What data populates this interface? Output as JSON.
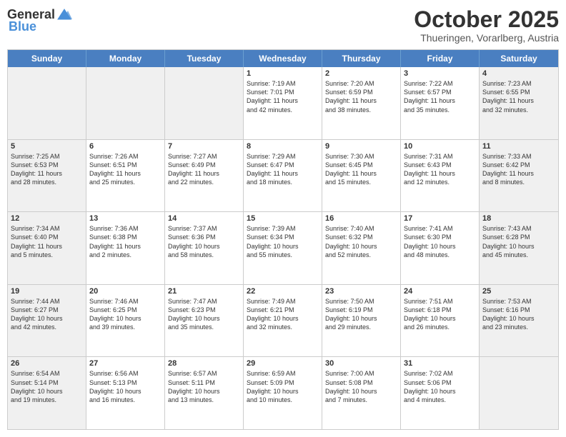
{
  "header": {
    "logo_general": "General",
    "logo_blue": "Blue",
    "month_title": "October 2025",
    "location": "Thueringen, Vorarlberg, Austria"
  },
  "days_of_week": [
    "Sunday",
    "Monday",
    "Tuesday",
    "Wednesday",
    "Thursday",
    "Friday",
    "Saturday"
  ],
  "weeks": [
    [
      {
        "day": "",
        "text": "",
        "shaded": true
      },
      {
        "day": "",
        "text": "",
        "shaded": true
      },
      {
        "day": "",
        "text": "",
        "shaded": true
      },
      {
        "day": "1",
        "text": "Sunrise: 7:19 AM\nSunset: 7:01 PM\nDaylight: 11 hours\nand 42 minutes.",
        "shaded": false
      },
      {
        "day": "2",
        "text": "Sunrise: 7:20 AM\nSunset: 6:59 PM\nDaylight: 11 hours\nand 38 minutes.",
        "shaded": false
      },
      {
        "day": "3",
        "text": "Sunrise: 7:22 AM\nSunset: 6:57 PM\nDaylight: 11 hours\nand 35 minutes.",
        "shaded": false
      },
      {
        "day": "4",
        "text": "Sunrise: 7:23 AM\nSunset: 6:55 PM\nDaylight: 11 hours\nand 32 minutes.",
        "shaded": true
      }
    ],
    [
      {
        "day": "5",
        "text": "Sunrise: 7:25 AM\nSunset: 6:53 PM\nDaylight: 11 hours\nand 28 minutes.",
        "shaded": true
      },
      {
        "day": "6",
        "text": "Sunrise: 7:26 AM\nSunset: 6:51 PM\nDaylight: 11 hours\nand 25 minutes.",
        "shaded": false
      },
      {
        "day": "7",
        "text": "Sunrise: 7:27 AM\nSunset: 6:49 PM\nDaylight: 11 hours\nand 22 minutes.",
        "shaded": false
      },
      {
        "day": "8",
        "text": "Sunrise: 7:29 AM\nSunset: 6:47 PM\nDaylight: 11 hours\nand 18 minutes.",
        "shaded": false
      },
      {
        "day": "9",
        "text": "Sunrise: 7:30 AM\nSunset: 6:45 PM\nDaylight: 11 hours\nand 15 minutes.",
        "shaded": false
      },
      {
        "day": "10",
        "text": "Sunrise: 7:31 AM\nSunset: 6:43 PM\nDaylight: 11 hours\nand 12 minutes.",
        "shaded": false
      },
      {
        "day": "11",
        "text": "Sunrise: 7:33 AM\nSunset: 6:42 PM\nDaylight: 11 hours\nand 8 minutes.",
        "shaded": true
      }
    ],
    [
      {
        "day": "12",
        "text": "Sunrise: 7:34 AM\nSunset: 6:40 PM\nDaylight: 11 hours\nand 5 minutes.",
        "shaded": true
      },
      {
        "day": "13",
        "text": "Sunrise: 7:36 AM\nSunset: 6:38 PM\nDaylight: 11 hours\nand 2 minutes.",
        "shaded": false
      },
      {
        "day": "14",
        "text": "Sunrise: 7:37 AM\nSunset: 6:36 PM\nDaylight: 10 hours\nand 58 minutes.",
        "shaded": false
      },
      {
        "day": "15",
        "text": "Sunrise: 7:39 AM\nSunset: 6:34 PM\nDaylight: 10 hours\nand 55 minutes.",
        "shaded": false
      },
      {
        "day": "16",
        "text": "Sunrise: 7:40 AM\nSunset: 6:32 PM\nDaylight: 10 hours\nand 52 minutes.",
        "shaded": false
      },
      {
        "day": "17",
        "text": "Sunrise: 7:41 AM\nSunset: 6:30 PM\nDaylight: 10 hours\nand 48 minutes.",
        "shaded": false
      },
      {
        "day": "18",
        "text": "Sunrise: 7:43 AM\nSunset: 6:28 PM\nDaylight: 10 hours\nand 45 minutes.",
        "shaded": true
      }
    ],
    [
      {
        "day": "19",
        "text": "Sunrise: 7:44 AM\nSunset: 6:27 PM\nDaylight: 10 hours\nand 42 minutes.",
        "shaded": true
      },
      {
        "day": "20",
        "text": "Sunrise: 7:46 AM\nSunset: 6:25 PM\nDaylight: 10 hours\nand 39 minutes.",
        "shaded": false
      },
      {
        "day": "21",
        "text": "Sunrise: 7:47 AM\nSunset: 6:23 PM\nDaylight: 10 hours\nand 35 minutes.",
        "shaded": false
      },
      {
        "day": "22",
        "text": "Sunrise: 7:49 AM\nSunset: 6:21 PM\nDaylight: 10 hours\nand 32 minutes.",
        "shaded": false
      },
      {
        "day": "23",
        "text": "Sunrise: 7:50 AM\nSunset: 6:19 PM\nDaylight: 10 hours\nand 29 minutes.",
        "shaded": false
      },
      {
        "day": "24",
        "text": "Sunrise: 7:51 AM\nSunset: 6:18 PM\nDaylight: 10 hours\nand 26 minutes.",
        "shaded": false
      },
      {
        "day": "25",
        "text": "Sunrise: 7:53 AM\nSunset: 6:16 PM\nDaylight: 10 hours\nand 23 minutes.",
        "shaded": true
      }
    ],
    [
      {
        "day": "26",
        "text": "Sunrise: 6:54 AM\nSunset: 5:14 PM\nDaylight: 10 hours\nand 19 minutes.",
        "shaded": true
      },
      {
        "day": "27",
        "text": "Sunrise: 6:56 AM\nSunset: 5:13 PM\nDaylight: 10 hours\nand 16 minutes.",
        "shaded": false
      },
      {
        "day": "28",
        "text": "Sunrise: 6:57 AM\nSunset: 5:11 PM\nDaylight: 10 hours\nand 13 minutes.",
        "shaded": false
      },
      {
        "day": "29",
        "text": "Sunrise: 6:59 AM\nSunset: 5:09 PM\nDaylight: 10 hours\nand 10 minutes.",
        "shaded": false
      },
      {
        "day": "30",
        "text": "Sunrise: 7:00 AM\nSunset: 5:08 PM\nDaylight: 10 hours\nand 7 minutes.",
        "shaded": false
      },
      {
        "day": "31",
        "text": "Sunrise: 7:02 AM\nSunset: 5:06 PM\nDaylight: 10 hours\nand 4 minutes.",
        "shaded": false
      },
      {
        "day": "",
        "text": "",
        "shaded": true
      }
    ]
  ]
}
